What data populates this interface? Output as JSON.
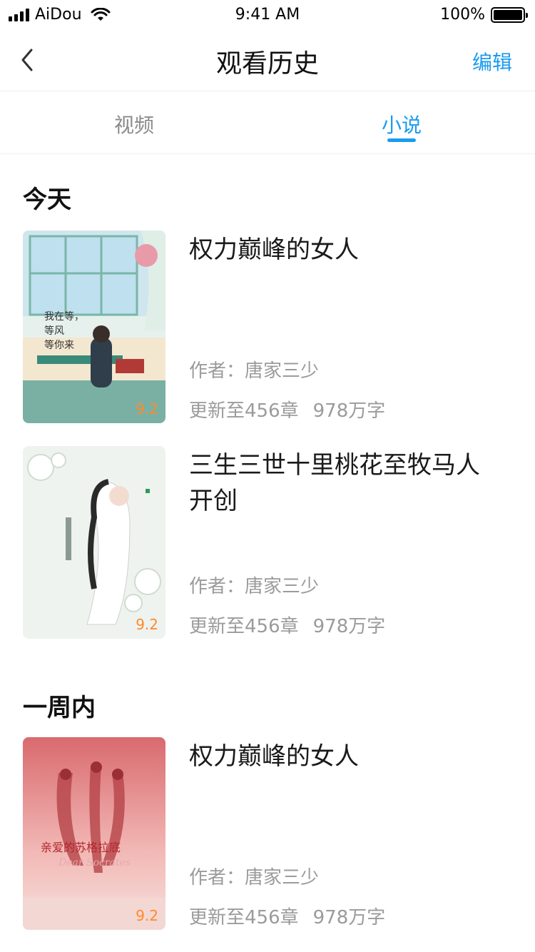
{
  "status_bar": {
    "carrier": "AiDou",
    "time": "9:41 AM",
    "battery": "100%"
  },
  "nav": {
    "title": "观看历史",
    "edit_label": "编辑",
    "back_icon": "chevron-left-icon"
  },
  "tabs": [
    {
      "label": "视频",
      "active": false
    },
    {
      "label": "小说",
      "active": true
    }
  ],
  "accent_color": "#1b9bf0",
  "score_color": "#ff8a2b",
  "sections": [
    {
      "title": "今天",
      "books": [
        {
          "title": "权力巅峰的女人",
          "author": "作者：唐家三少",
          "chapters": "更新至456章",
          "words": "978万字",
          "score": "9.2"
        },
        {
          "title": "三生三世十里桃花至牧马人开创",
          "author": "作者：唐家三少",
          "chapters": "更新至456章",
          "words": "978万字",
          "score": "9.2"
        }
      ]
    },
    {
      "title": "一周内",
      "books": [
        {
          "title": "权力巅峰的女人",
          "author": "作者：唐家三少",
          "chapters": "更新至456章",
          "words": "978万字",
          "score": "9.2"
        }
      ]
    }
  ]
}
